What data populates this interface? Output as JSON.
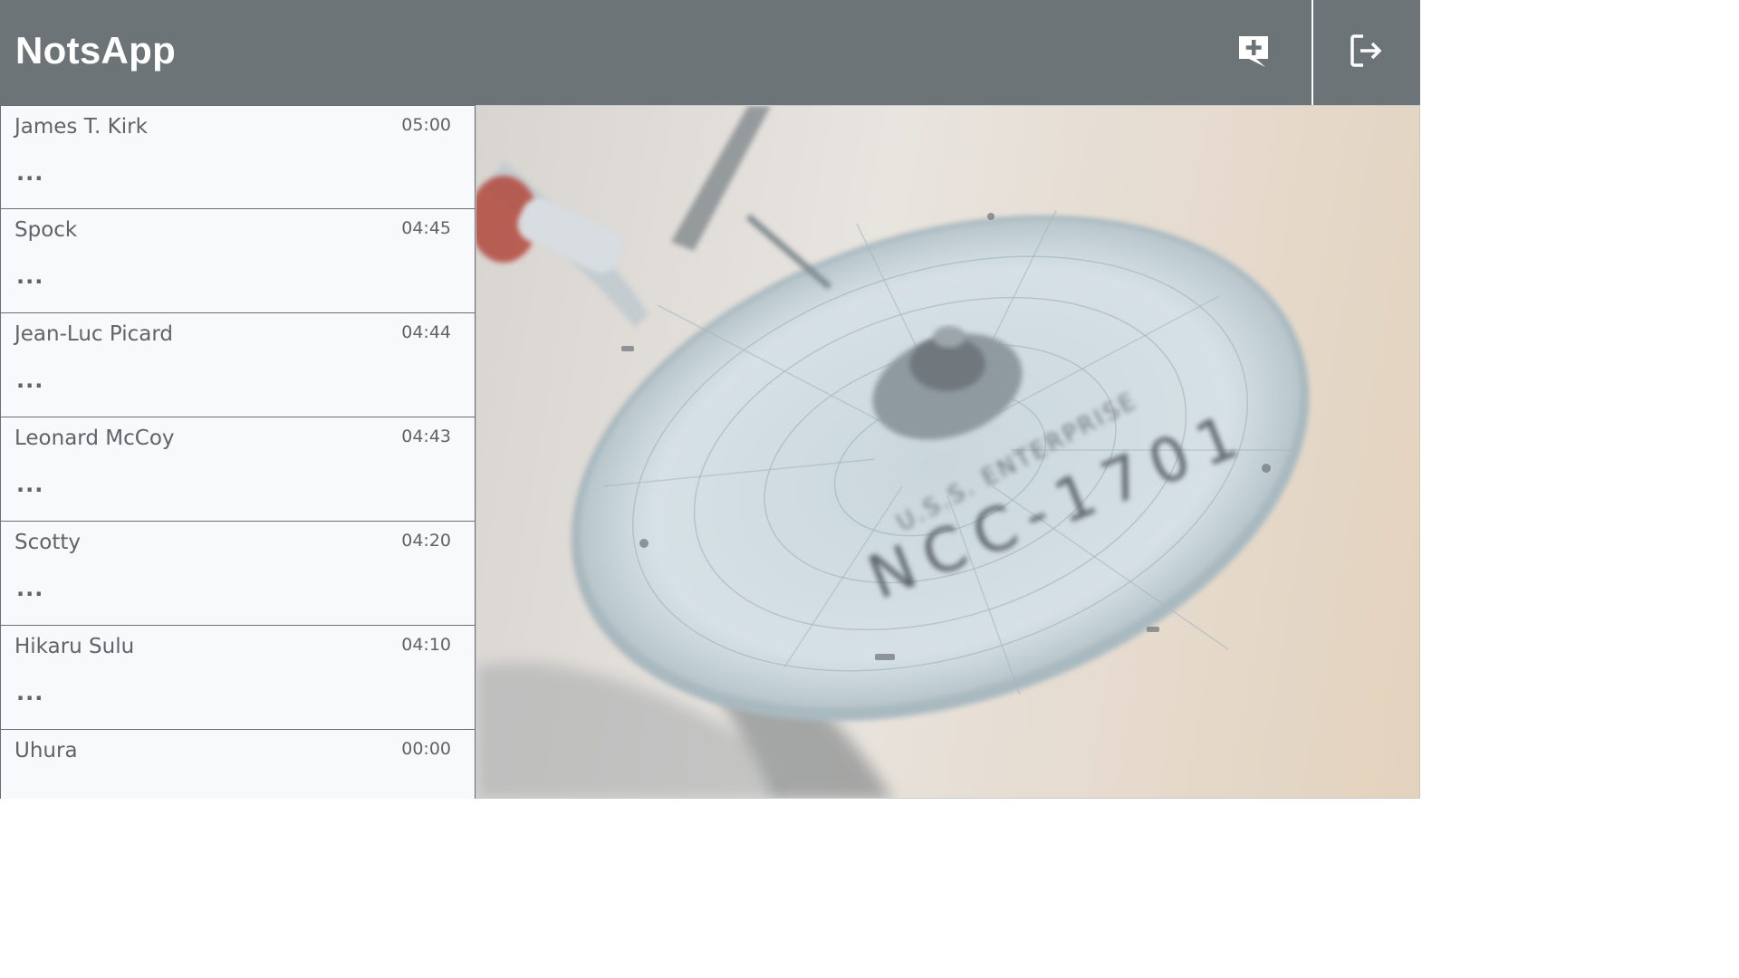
{
  "app": {
    "title": "NotsApp"
  },
  "header": {
    "new_chat_icon": "message-plus-icon",
    "logout_icon": "logout-icon"
  },
  "chats": [
    {
      "name": "James T. Kirk",
      "time": "05:00",
      "preview": "..."
    },
    {
      "name": "Spock",
      "time": "04:45",
      "preview": "..."
    },
    {
      "name": "Jean-Luc Picard",
      "time": "04:44",
      "preview": "..."
    },
    {
      "name": "Leonard McCoy",
      "time": "04:43",
      "preview": "..."
    },
    {
      "name": "Scotty",
      "time": "04:20",
      "preview": "..."
    },
    {
      "name": "Hikaru Sulu",
      "time": "04:10",
      "preview": "..."
    },
    {
      "name": "Uhura",
      "time": "00:00",
      "preview": "..."
    }
  ],
  "background": {
    "registry_text": "NCC-1701",
    "ship_text": "U.S.S. ENTERPRISE"
  },
  "colors": {
    "header": "#6c7478",
    "sidebar": "#f7f9fb",
    "text": "#5f6469"
  }
}
